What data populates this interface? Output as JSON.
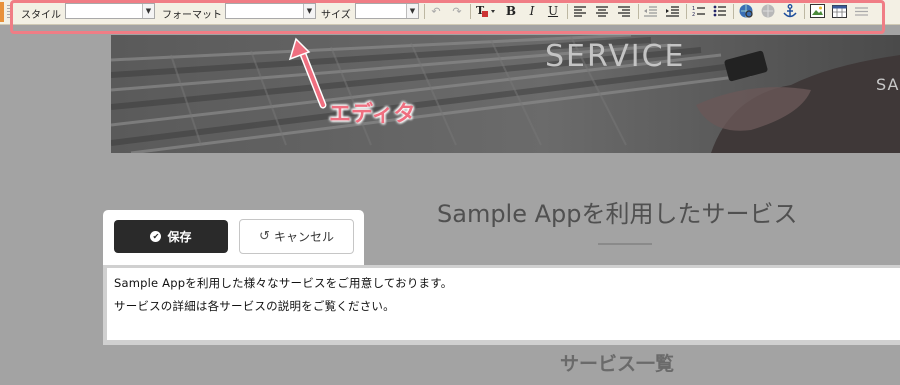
{
  "toolbar": {
    "style_label": "スタイル",
    "style_value": "",
    "format_label": "フォーマット",
    "format_value": "",
    "size_label": "サイズ",
    "size_value": "",
    "buttons": [
      "undo-icon",
      "redo-icon",
      "text-color-icon",
      "bold-icon",
      "italic-icon",
      "underline-icon",
      "align-left-icon",
      "align-center-icon",
      "align-right-icon",
      "outdent-icon",
      "indent-icon",
      "ordered-list-icon",
      "unordered-list-icon",
      "link-icon",
      "unlink-icon",
      "anchor-icon",
      "image-icon",
      "table-icon",
      "horizontal-rule-icon"
    ],
    "bold_glyph": "B",
    "italic_glyph": "I",
    "underline_glyph": "U"
  },
  "annotation": {
    "label": "エディタ",
    "color": "#ef6f80"
  },
  "hero": {
    "title": "SERVICE",
    "cut_text": "SA"
  },
  "section": {
    "title": "Sample Appを利用したサービス",
    "subtitle": "サービス一覧"
  },
  "actions": {
    "save_label": "保存",
    "cancel_label": "キャンセル"
  },
  "editor": {
    "lines": [
      "Sample Appを利用した様々なサービスをご用意しております。",
      "サービスの詳細は各サービスの説明をご覧ください。"
    ]
  }
}
